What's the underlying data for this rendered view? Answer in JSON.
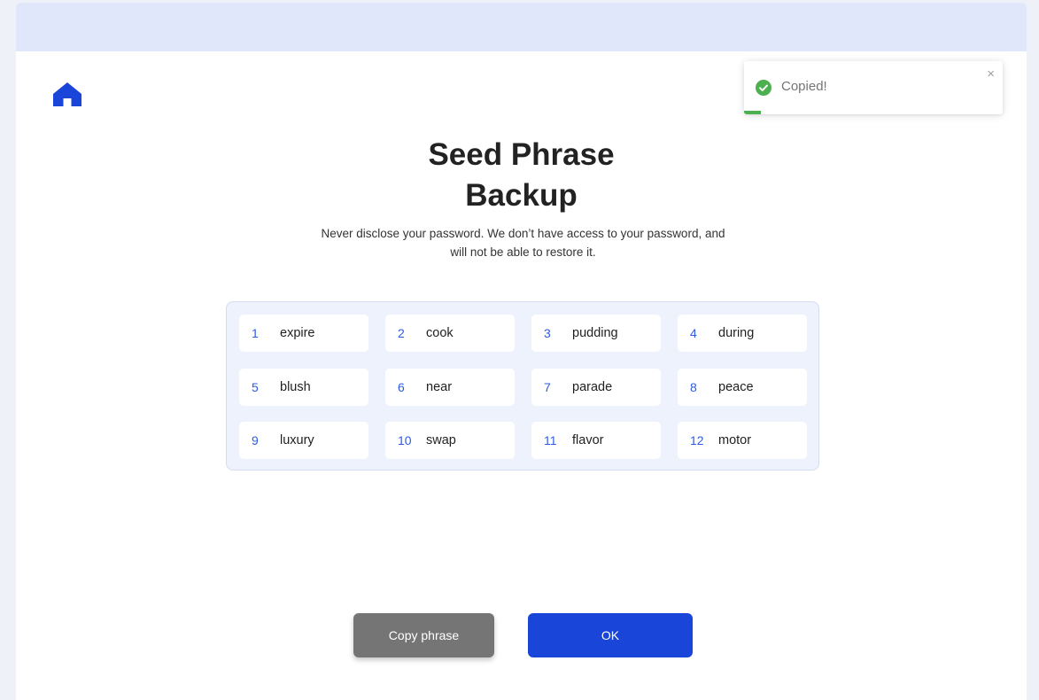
{
  "toast": {
    "message": "Copied!",
    "close_symbol": "×",
    "status_color": "#4caf50",
    "icon": "check-circle-icon"
  },
  "nav": {
    "home_icon": "home-icon",
    "accent_color": "#1a45d9"
  },
  "header": {
    "title_line1": "Seed Phrase",
    "title_line2": "Backup",
    "subtitle": "Never disclose your password. We don’t have access to your password, and will not be able to restore it."
  },
  "phrase": {
    "words": [
      {
        "index": "1",
        "word": "expire"
      },
      {
        "index": "2",
        "word": "cook"
      },
      {
        "index": "3",
        "word": "pudding"
      },
      {
        "index": "4",
        "word": "during"
      },
      {
        "index": "5",
        "word": "blush"
      },
      {
        "index": "6",
        "word": "near"
      },
      {
        "index": "7",
        "word": "parade"
      },
      {
        "index": "8",
        "word": "peace"
      },
      {
        "index": "9",
        "word": "luxury"
      },
      {
        "index": "10",
        "word": "swap"
      },
      {
        "index": "11",
        "word": "flavor"
      },
      {
        "index": "12",
        "word": "motor"
      }
    ]
  },
  "actions": {
    "copy_label": "Copy phrase",
    "ok_label": "OK"
  }
}
